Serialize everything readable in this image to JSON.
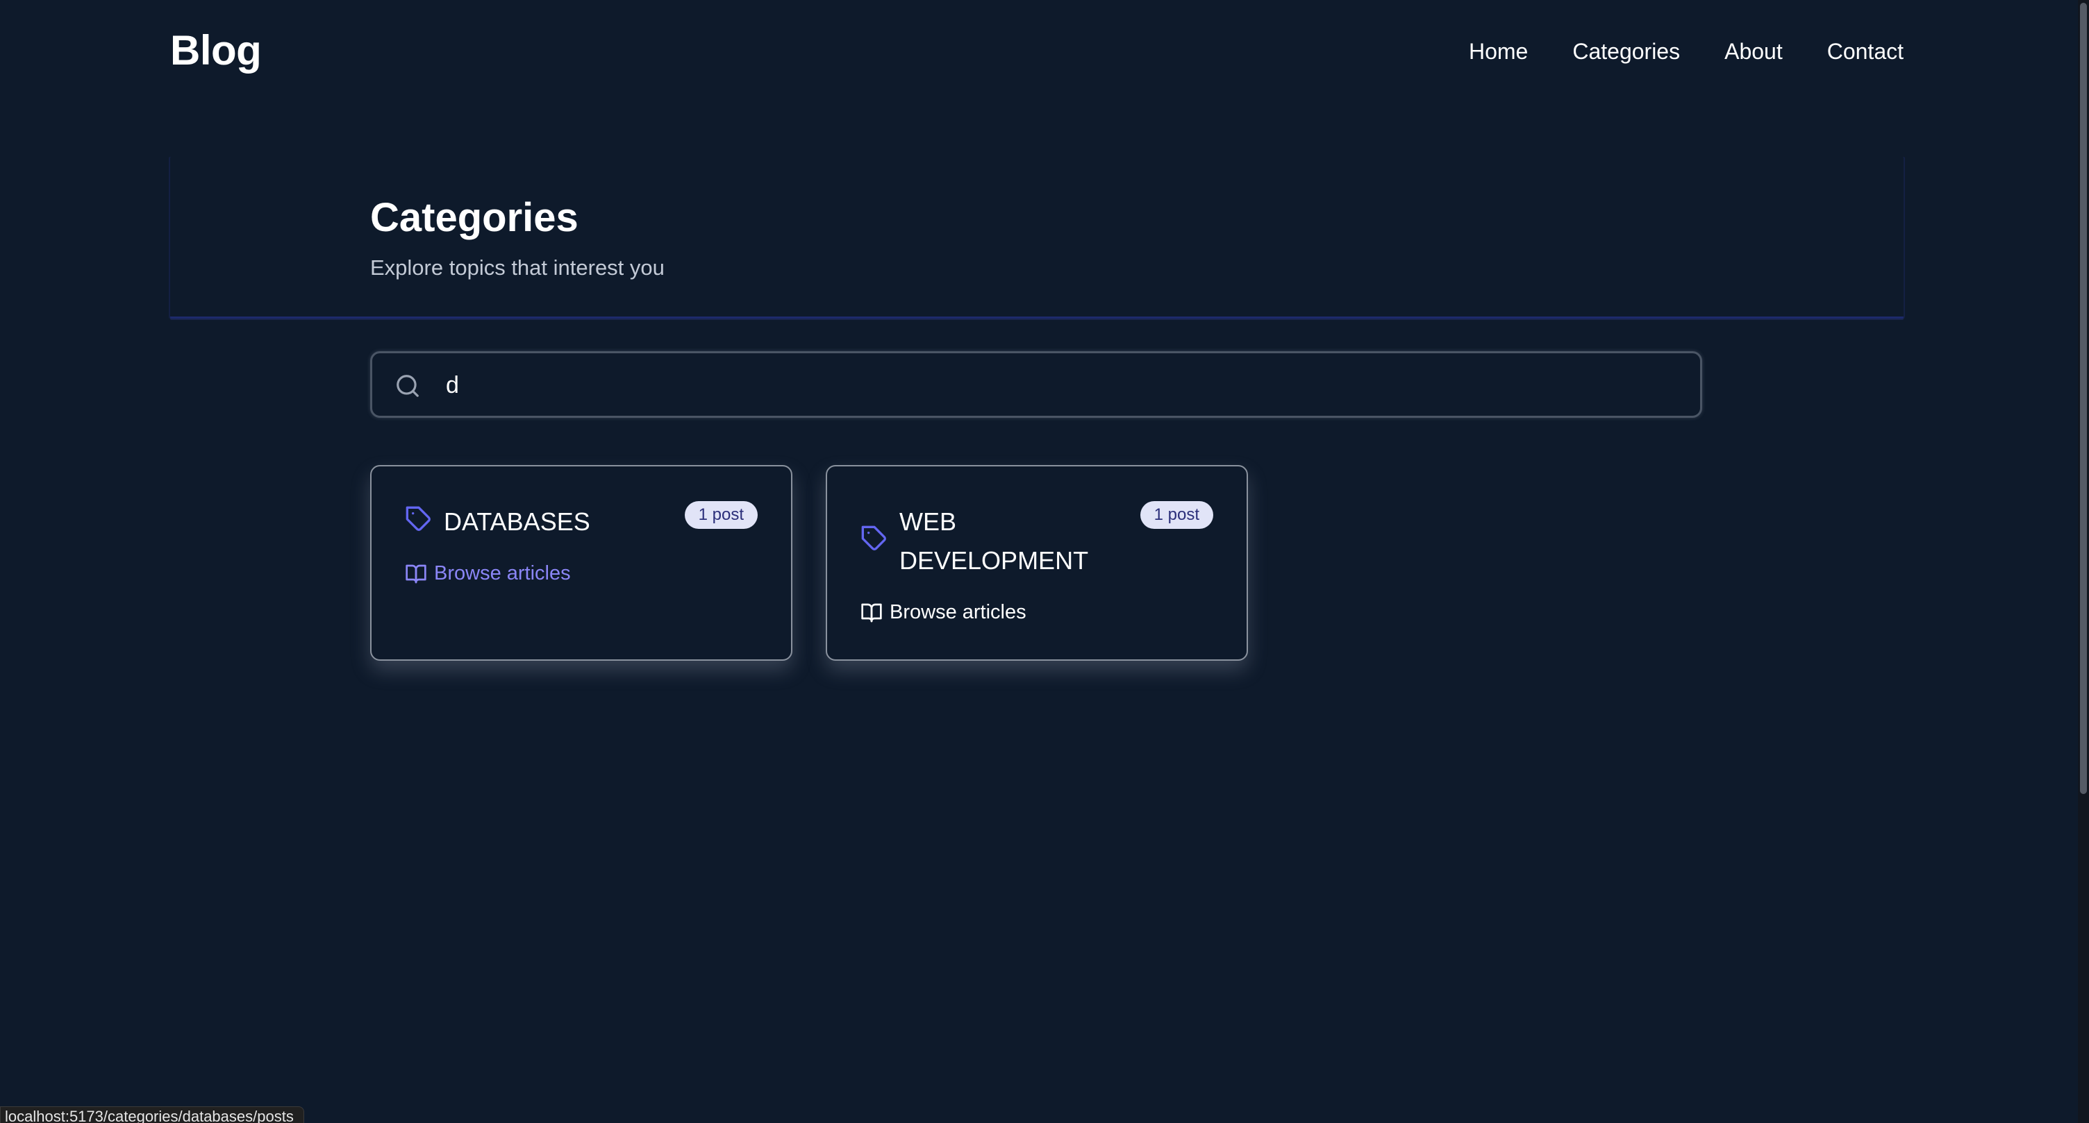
{
  "header": {
    "brand": "Blog",
    "nav": [
      "Home",
      "Categories",
      "About",
      "Contact"
    ]
  },
  "hero": {
    "title": "Categories",
    "subtitle": "Explore topics that interest you"
  },
  "search": {
    "value": "d",
    "placeholder": ""
  },
  "categories": [
    {
      "name": "DATABASES",
      "count": "1 post",
      "action": "Browse articles"
    },
    {
      "name": "WEB DEVELOPMENT",
      "count": "1 post",
      "action": "Browse articles"
    }
  ],
  "status_bar": {
    "url": "localhost:5173/categories/databases/posts"
  },
  "colors": {
    "background": "#0e1a2b",
    "accent": "#6366f1",
    "link_active": "#8b86f7",
    "badge_bg": "#e1e4f7",
    "badge_text": "#2b2f7a"
  },
  "icons": {
    "search": "search-icon",
    "tag": "tag-icon",
    "book": "book-open-icon"
  }
}
